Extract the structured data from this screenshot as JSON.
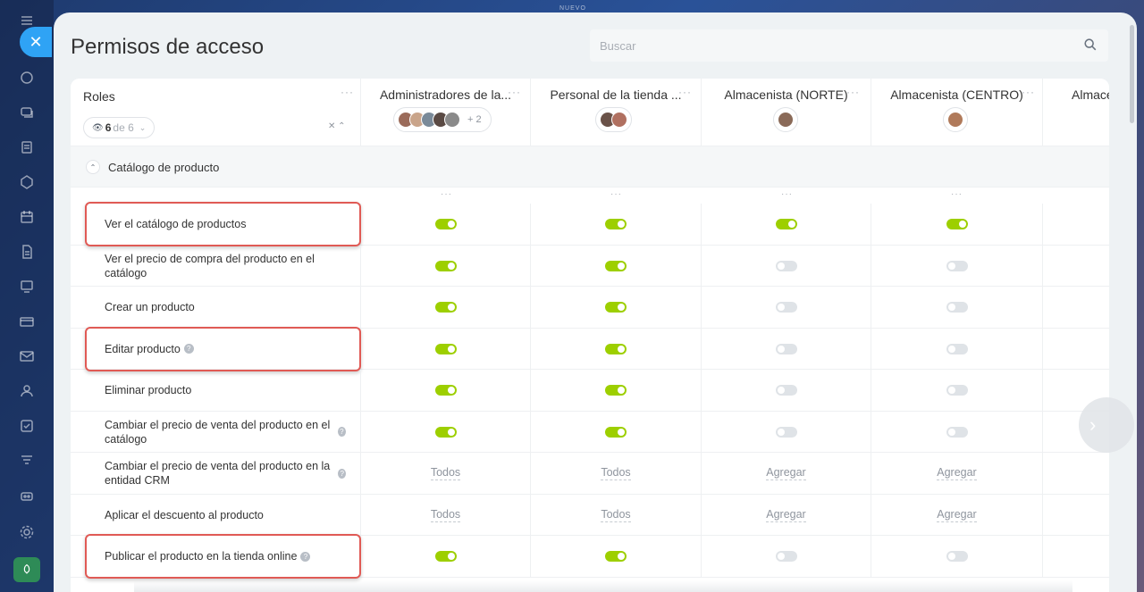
{
  "background_label": "NUEVO",
  "panel": {
    "title": "Permisos de acceso",
    "search_placeholder": "Buscar"
  },
  "roles_header": {
    "label": "Roles",
    "filter_count": "6",
    "filter_of": "de 6"
  },
  "columns": [
    {
      "title": "Administradores de la...",
      "avatars": 4,
      "more": "+ 2"
    },
    {
      "title": "Personal de la tienda ...",
      "avatars": 2,
      "more": ""
    },
    {
      "title": "Almacenista (NORTE)",
      "avatars": 1,
      "more": ""
    },
    {
      "title": "Almacenista (CENTRO)",
      "avatars": 1,
      "more": ""
    },
    {
      "title": "Almacenista",
      "avatars": 0,
      "more": ""
    }
  ],
  "section": {
    "label": "Catálogo de producto"
  },
  "rows": [
    {
      "label": "Ver el catálogo de productos",
      "help": false,
      "highlight": true,
      "values": [
        "on",
        "on",
        "on",
        "on"
      ]
    },
    {
      "label": "Ver el precio de compra del producto en el catálogo",
      "help": false,
      "highlight": false,
      "values": [
        "on",
        "on",
        "off",
        "off"
      ]
    },
    {
      "label": "Crear un producto",
      "help": false,
      "highlight": false,
      "values": [
        "on",
        "on",
        "off",
        "off"
      ]
    },
    {
      "label": "Editar producto",
      "help": true,
      "highlight": true,
      "values": [
        "on",
        "on",
        "off",
        "off"
      ]
    },
    {
      "label": "Eliminar producto",
      "help": false,
      "highlight": false,
      "values": [
        "on",
        "on",
        "off",
        "off"
      ]
    },
    {
      "label": "Cambiar el precio de venta del producto en el catálogo",
      "help": true,
      "highlight": false,
      "values": [
        "on",
        "on",
        "off",
        "off"
      ]
    },
    {
      "label": "Cambiar el precio de venta del producto en la entidad CRM",
      "help": true,
      "highlight": false,
      "values": [
        "Todos",
        "Todos",
        "Agregar",
        "Agregar"
      ]
    },
    {
      "label": "Aplicar el descuento al producto",
      "help": false,
      "highlight": false,
      "values": [
        "Todos",
        "Todos",
        "Agregar",
        "Agregar"
      ]
    },
    {
      "label": "Publicar el producto en la tienda online",
      "help": true,
      "highlight": true,
      "values": [
        "on",
        "on",
        "off",
        "off"
      ]
    }
  ],
  "colors": {
    "toggle_on": "#9dcf00",
    "toggle_off": "#dfe3e7",
    "highlight": "#e05a55",
    "close_button": "#2fa3f5"
  }
}
